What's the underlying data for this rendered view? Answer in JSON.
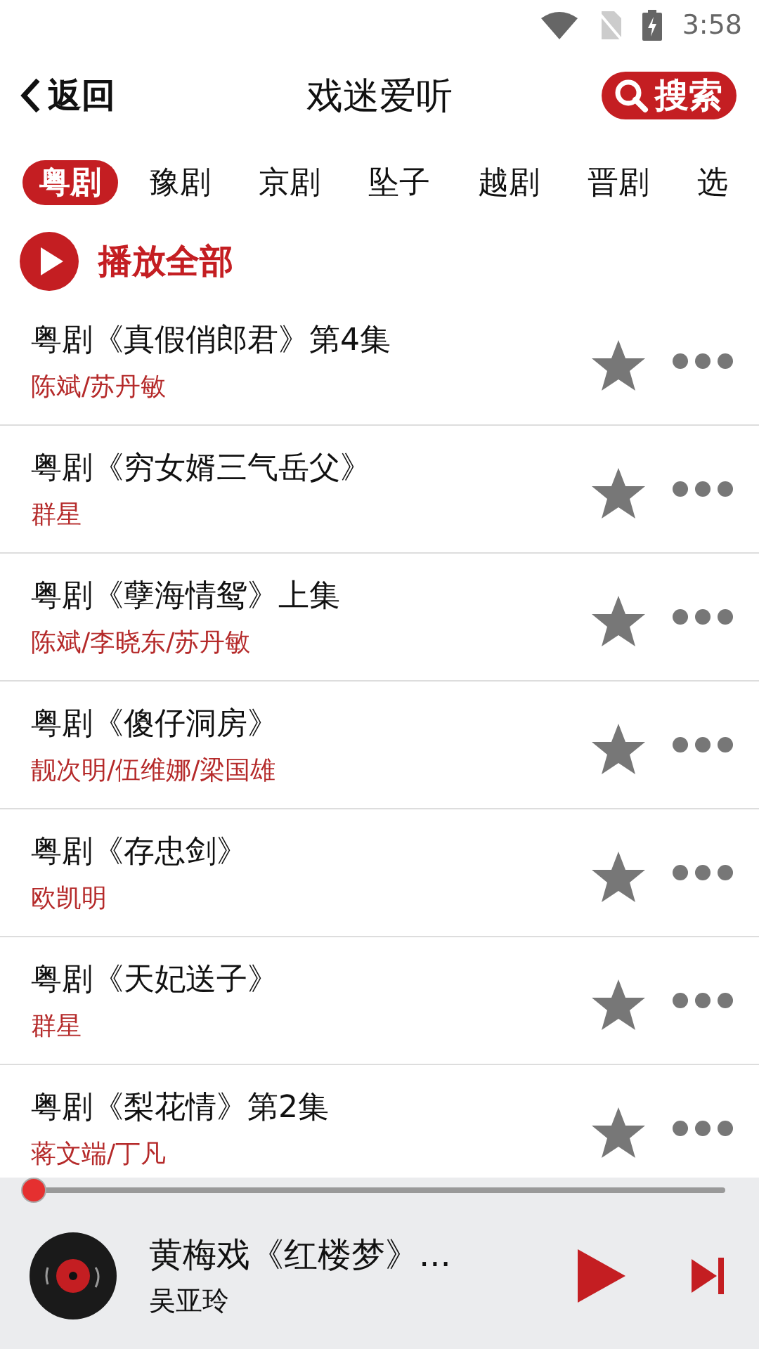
{
  "status_bar": {
    "time": "3:58"
  },
  "header": {
    "back": "返回",
    "title": "戏迷爱听",
    "search": "搜索"
  },
  "tabs": [
    {
      "label": "粤剧",
      "selected": true
    },
    {
      "label": "豫剧",
      "selected": false
    },
    {
      "label": "京剧",
      "selected": false
    },
    {
      "label": "坠子",
      "selected": false
    },
    {
      "label": "越剧",
      "selected": false
    },
    {
      "label": "晋剧",
      "selected": false
    },
    {
      "label": "选",
      "selected": false
    }
  ],
  "play_all": "播放全部",
  "tracks": [
    {
      "title": "粤剧《真假俏郎君》第4集",
      "artist": "陈斌/苏丹敏",
      "favorite": false
    },
    {
      "title": "粤剧《穷女婿三气岳父》",
      "artist": "群星",
      "favorite": false
    },
    {
      "title": "粤剧《孽海情鸳》上集",
      "artist": "陈斌/李晓东/苏丹敏",
      "favorite": false
    },
    {
      "title": "粤剧《傻仔洞房》",
      "artist": "靓次明/伍维娜/梁国雄",
      "favorite": false
    },
    {
      "title": "粤剧《存忠剑》",
      "artist": "欧凯明",
      "favorite": false
    },
    {
      "title": "粤剧《天妃送子》",
      "artist": "群星",
      "favorite": false
    },
    {
      "title": "粤剧《梨花情》第2集",
      "artist": "蒋文端/丁凡",
      "favorite": false
    }
  ],
  "player": {
    "level": 0,
    "title": "黄梅戏《红楼梦》...",
    "artist": "吴亚玲"
  }
}
